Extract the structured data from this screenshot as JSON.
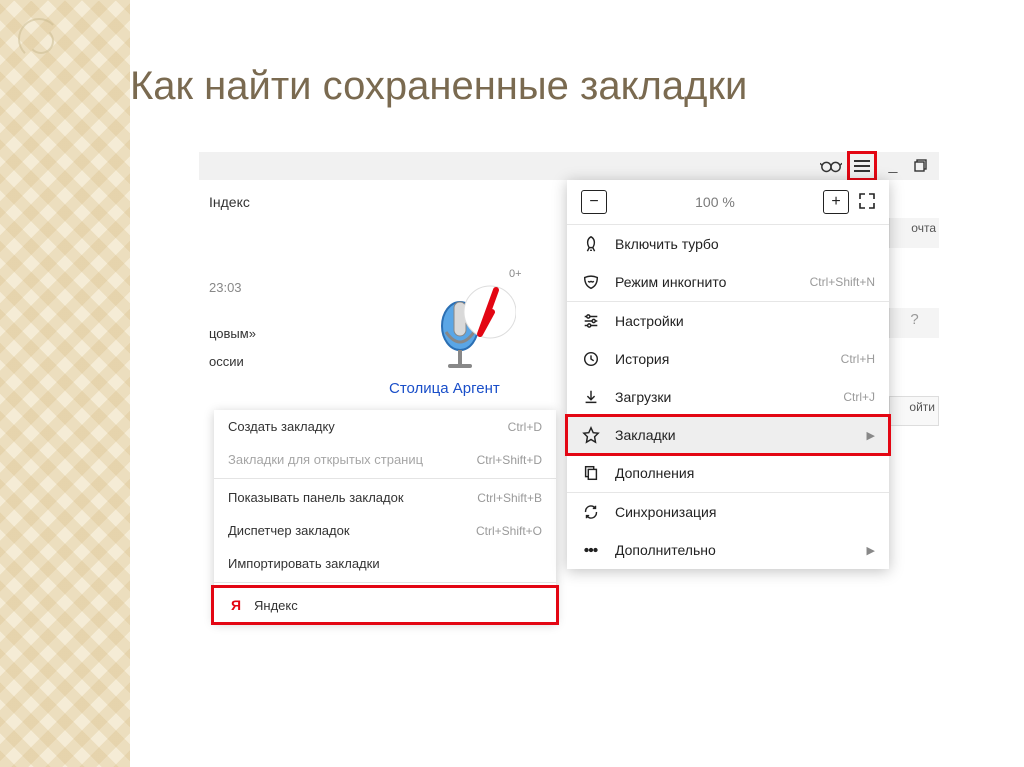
{
  "slide": {
    "title": "Как найти сохраненные закладки"
  },
  "topbar": {
    "glasses_title": "Режим чтения",
    "minimize": "_",
    "restore": "❐"
  },
  "page": {
    "tab_label": "Iндекс",
    "time": "23:03",
    "frag1": "цовым»",
    "frag2": "оссии",
    "age_badge": "0+",
    "caption": "Столица Аргент",
    "right_mail": "очта",
    "right_help": "?",
    "right_login": "ойти"
  },
  "submenu": {
    "items": [
      {
        "label": "Создать закладку",
        "shortcut": "Ctrl+D",
        "disabled": false
      },
      {
        "label": "Закладки для открытых страниц",
        "shortcut": "Ctrl+Shift+D",
        "disabled": true
      }
    ],
    "group2": [
      {
        "label": "Показывать панель закладок",
        "shortcut": "Ctrl+Shift+B"
      },
      {
        "label": "Диспетчер закладок",
        "shortcut": "Ctrl+Shift+O"
      },
      {
        "label": "Импортировать закладки",
        "shortcut": ""
      }
    ],
    "yandex": "Яндекс"
  },
  "menu": {
    "zoom": {
      "value": "100 %"
    },
    "items": [
      {
        "icon": "rocket",
        "label": "Включить турбо",
        "shortcut": "",
        "arrow": false,
        "hl": false
      },
      {
        "icon": "mask",
        "label": "Режим инкогнито",
        "shortcut": "Ctrl+Shift+N",
        "arrow": false,
        "hl": false
      },
      {
        "sep": true
      },
      {
        "icon": "sliders",
        "label": "Настройки",
        "shortcut": "",
        "arrow": false,
        "hl": false
      },
      {
        "icon": "clock",
        "label": "История",
        "shortcut": "Ctrl+H",
        "arrow": false,
        "hl": false
      },
      {
        "icon": "download",
        "label": "Загрузки",
        "shortcut": "Ctrl+J",
        "arrow": false,
        "hl": false
      },
      {
        "icon": "star",
        "label": "Закладки",
        "shortcut": "",
        "arrow": true,
        "hl": true
      },
      {
        "icon": "copy",
        "label": "Дополнения",
        "shortcut": "",
        "arrow": false,
        "hl": false
      },
      {
        "sep": true
      },
      {
        "icon": "sync",
        "label": "Синхронизация",
        "shortcut": "",
        "arrow": false,
        "hl": false
      },
      {
        "icon": "dots",
        "label": "Дополнительно",
        "shortcut": "",
        "arrow": true,
        "hl": false
      }
    ]
  }
}
